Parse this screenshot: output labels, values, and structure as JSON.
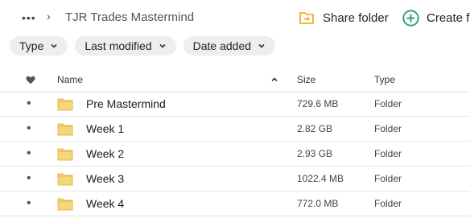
{
  "breadcrumb": {
    "more_label": "•••",
    "separator": "›",
    "current": "TJR Trades Mastermind"
  },
  "actions": {
    "share_folder": "Share folder",
    "create": "Create fo"
  },
  "filters": [
    {
      "label": "Type"
    },
    {
      "label": "Last modified"
    },
    {
      "label": "Date added"
    }
  ],
  "table": {
    "columns": {
      "name": "Name",
      "size": "Size",
      "type": "Type"
    },
    "sort": {
      "column": "name",
      "direction": "ascending"
    },
    "rows": [
      {
        "bullet": "•",
        "name": "Pre Mastermind",
        "size": "729.6 MB",
        "type": "Folder"
      },
      {
        "bullet": "•",
        "name": "Week 1",
        "size": "2.82 GB",
        "type": "Folder"
      },
      {
        "bullet": "•",
        "name": "Week 2",
        "size": "2.93 GB",
        "type": "Folder"
      },
      {
        "bullet": "•",
        "name": "Week 3",
        "size": "1022.4 MB",
        "type": "Folder"
      },
      {
        "bullet": "•",
        "name": "Week 4",
        "size": "772.0 MB",
        "type": "Folder"
      }
    ]
  },
  "icons": {
    "folder": "folder-icon",
    "heart": "heart-icon",
    "share": "share-folder-icon",
    "create": "plus-circle-icon"
  },
  "colors": {
    "folder": "#f5d67a",
    "share_accent": "#f0a400",
    "create_accent": "#1e9e6a"
  }
}
